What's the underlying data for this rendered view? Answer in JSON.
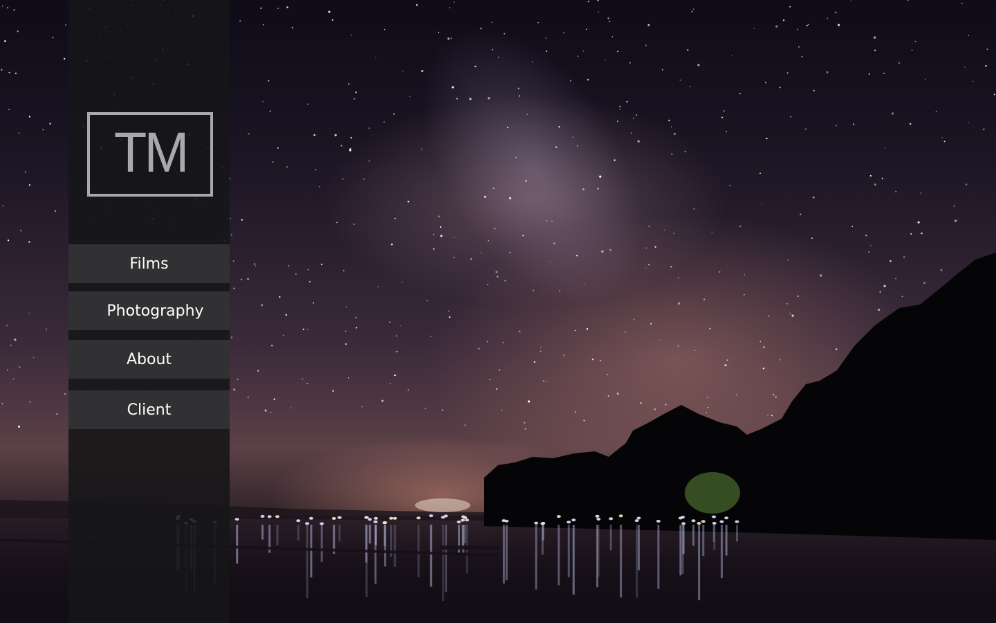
{
  "logo": {
    "text": "TM"
  },
  "nav": {
    "items": [
      {
        "label": "Films"
      },
      {
        "label": "Photography"
      },
      {
        "label": "About"
      },
      {
        "label": "Client"
      }
    ]
  },
  "colors": {
    "sidebar_bg": "#161618",
    "nav_item_bg": "#343436",
    "logo_gray": "#a9a9a9",
    "nav_text": "#ffffff"
  }
}
